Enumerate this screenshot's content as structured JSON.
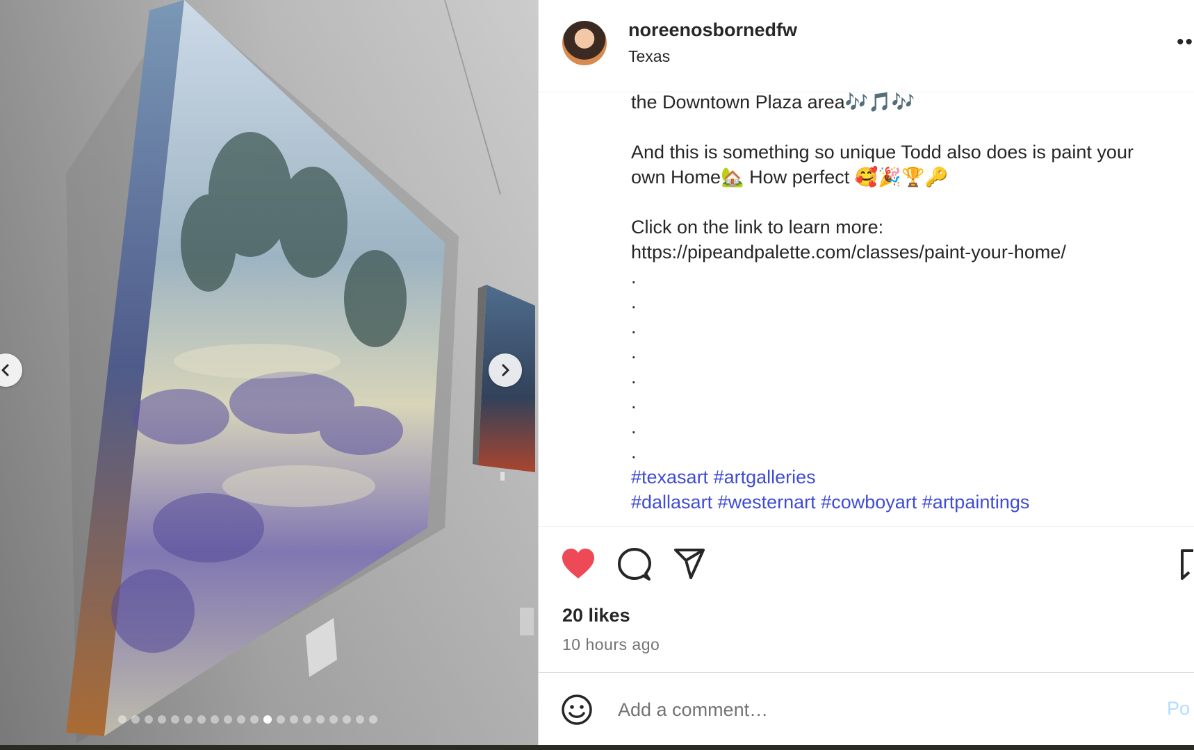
{
  "media": {
    "slide_count": 20,
    "active_slide_index": 11,
    "prev_icon": "chevron-left-icon",
    "next_icon": "chevron-right-icon"
  },
  "post": {
    "username": "noreenosbornedfw",
    "location": "Texas",
    "more_icon": "more-horizontal-icon"
  },
  "caption": {
    "lines": [
      "the Downtown Plaza area🎶🎵🎶",
      "",
      "And this is something so unique Todd also does is paint your",
      "own Home🏡 How perfect 🥰🎉🏆🔑",
      "",
      "Click on the link to learn more:"
    ],
    "link": "https://pipeandpalette.com/classes/paint-your-home/",
    "dots": [
      ".",
      ".",
      ".",
      ".",
      ".",
      ".",
      ".",
      "."
    ],
    "hashtag_lines": [
      [
        "#texasart",
        "#artgalleries"
      ],
      [
        "#dallasart",
        "#westernart",
        "#cowboyart",
        "#artpaintings"
      ]
    ]
  },
  "actions": {
    "like_icon": "heart-icon",
    "comment_icon": "comment-icon",
    "share_icon": "send-icon",
    "save_icon": "bookmark-icon",
    "liked": true,
    "like_color": "#ed4956"
  },
  "likes": "20 likes",
  "timestamp": "10 hours ago",
  "comment_box": {
    "emoji_icon": "smiley-icon",
    "placeholder": "Add a comment…",
    "post_label": "Po"
  }
}
